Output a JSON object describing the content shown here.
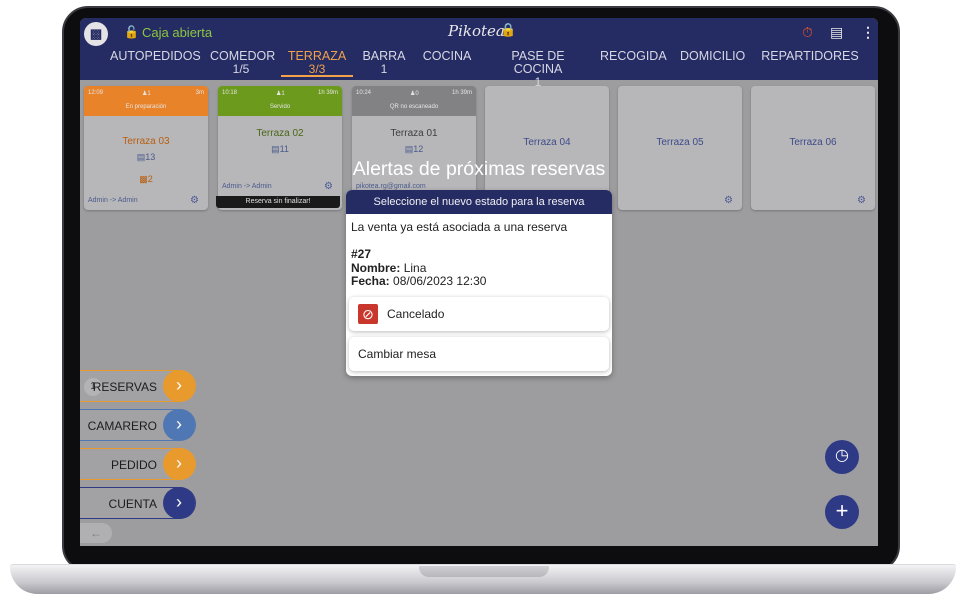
{
  "header": {
    "caja_status": "Caja abierta",
    "brand": "Pikotea",
    "colors": {
      "bar": "#252b63",
      "accent": "#f1a24a",
      "open": "#8dc63f"
    }
  },
  "tabs": [
    {
      "label": "AUTOPEDIDOS",
      "count": ""
    },
    {
      "label": "COMEDOR",
      "count": "1/5"
    },
    {
      "label": "TERRAZA",
      "count": "3/3",
      "active": true
    },
    {
      "label": "BARRA",
      "count": "1"
    },
    {
      "label": "COCINA",
      "count": ""
    },
    {
      "label": "PASE DE COCINA",
      "count": "1"
    },
    {
      "label": "RECOGIDA",
      "count": ""
    },
    {
      "label": "DOMICILIO",
      "count": ""
    },
    {
      "label": "REPARTIDORES",
      "count": ""
    }
  ],
  "tables": [
    {
      "name": "Terraza 03",
      "time": "12:09",
      "people": "1",
      "duration": "3m",
      "status": "En preparación",
      "order": "13",
      "extra": "2",
      "footer": "Admin -> Admin",
      "color": "#e8832a"
    },
    {
      "name": "Terraza 02",
      "time": "10:18",
      "people": "1",
      "duration": "1h 39m",
      "status": "Servido",
      "order": "11",
      "footer": "Admin -> Admin",
      "banner": "Reserva sin finalizar!",
      "color": "#6c9a1c"
    },
    {
      "name": "Terraza 01",
      "time": "10:24",
      "people": "0",
      "duration": "1h 39m",
      "status": "QR no escaneado",
      "order": "12",
      "footer": "pikotea.rg@gmail.com",
      "color": "#828284"
    },
    {
      "name": "Terraza 04"
    },
    {
      "name": "Terraza 05"
    },
    {
      "name": "Terraza 06"
    }
  ],
  "side_buttons": [
    {
      "label": "RESERVAS",
      "count": "1",
      "color": "#e89a2c"
    },
    {
      "label": "CAMARERO",
      "color": "#4f77b4"
    },
    {
      "label": "PEDIDO",
      "color": "#e89a2c"
    },
    {
      "label": "CUENTA",
      "color": "#2f3a86"
    }
  ],
  "overlay": {
    "title": "Alertas de próximas reservas"
  },
  "dialog": {
    "header": "Seleccione el nuevo estado para la reserva",
    "message": "La venta ya está asociada a una reserva",
    "number": "#27",
    "name_label": "Nombre:",
    "name": "Lina",
    "date_label": "Fecha:",
    "date": "08/06/2023 12:30",
    "option_cancel": "Cancelado",
    "option_change": "Cambiar mesa"
  },
  "icons": [
    "laptop-icon",
    "lock-icon",
    "timer-off-icon",
    "printer-icon",
    "more-icon",
    "people-icon",
    "order-icon",
    "gear-icon",
    "chevron-right-icon",
    "back-arrow-icon",
    "reservation-icon",
    "plus-icon",
    "cancel-icon"
  ]
}
